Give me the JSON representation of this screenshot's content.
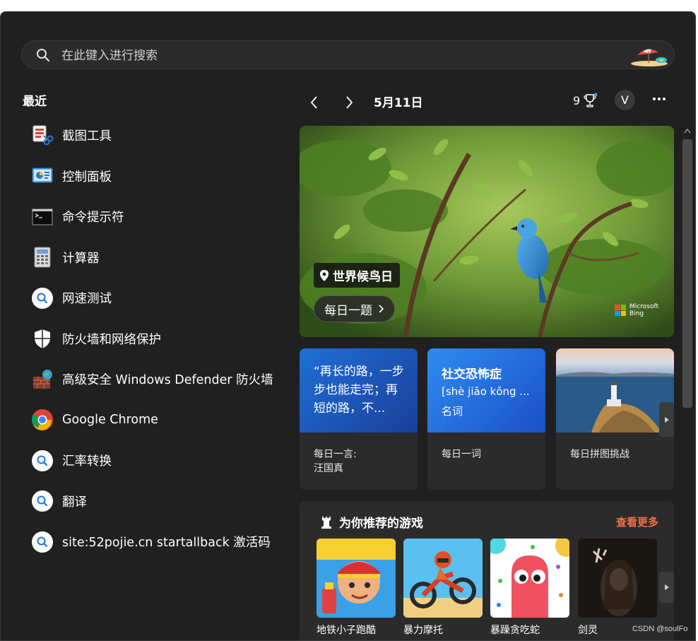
{
  "search": {
    "placeholder": "在此键入进行搜索"
  },
  "recent": {
    "title": "最近",
    "items": [
      {
        "label": "截图工具",
        "icon": "snipping-tool-icon"
      },
      {
        "label": "控制面板",
        "icon": "control-panel-icon"
      },
      {
        "label": "命令提示符",
        "icon": "command-prompt-icon"
      },
      {
        "label": "计算器",
        "icon": "calculator-icon"
      },
      {
        "label": "网速测试",
        "icon": "web-search-icon"
      },
      {
        "label": "防火墙和网络保护",
        "icon": "shield-icon"
      },
      {
        "label": "高级安全 Windows Defender 防火墙",
        "icon": "firewall-icon"
      },
      {
        "label": "Google Chrome",
        "icon": "chrome-icon"
      },
      {
        "label": "汇率转换",
        "icon": "web-search-icon"
      },
      {
        "label": "翻译",
        "icon": "web-search-icon"
      },
      {
        "label": "site:52pojie.cn startallback 激活码",
        "icon": "web-search-icon"
      }
    ]
  },
  "header": {
    "date": "5月11日",
    "points": "9",
    "avatar": "V"
  },
  "hero": {
    "tag": "世界候鸟日",
    "button": "每日一题",
    "brand_line1": "Microsoft",
    "brand_line2": "Bing"
  },
  "cards": {
    "quote": {
      "text": "“再长的路，一步步也能走完；再短的路，不...",
      "caption_line1": "每日一言:",
      "caption_line2": "汪国真"
    },
    "word": {
      "title": "社交恐怖症",
      "pinyin": "[shè jiāo kǒng ...",
      "pos": "名词",
      "caption": "每日一词"
    },
    "puzzle": {
      "caption": "每日拼图挑战"
    }
  },
  "games": {
    "title": "为你推荐的游戏",
    "more": "查看更多",
    "items": [
      {
        "name": "地铁小子跑酷"
      },
      {
        "name": "暴力摩托"
      },
      {
        "name": "暴躁贪吃蛇"
      },
      {
        "name": "剑灵"
      }
    ]
  },
  "watermark": "CSDN @soulFo",
  "colors": {
    "accent_orange": "#f07045",
    "window_bg": "#202020",
    "card_bg": "#2b2b2b"
  }
}
